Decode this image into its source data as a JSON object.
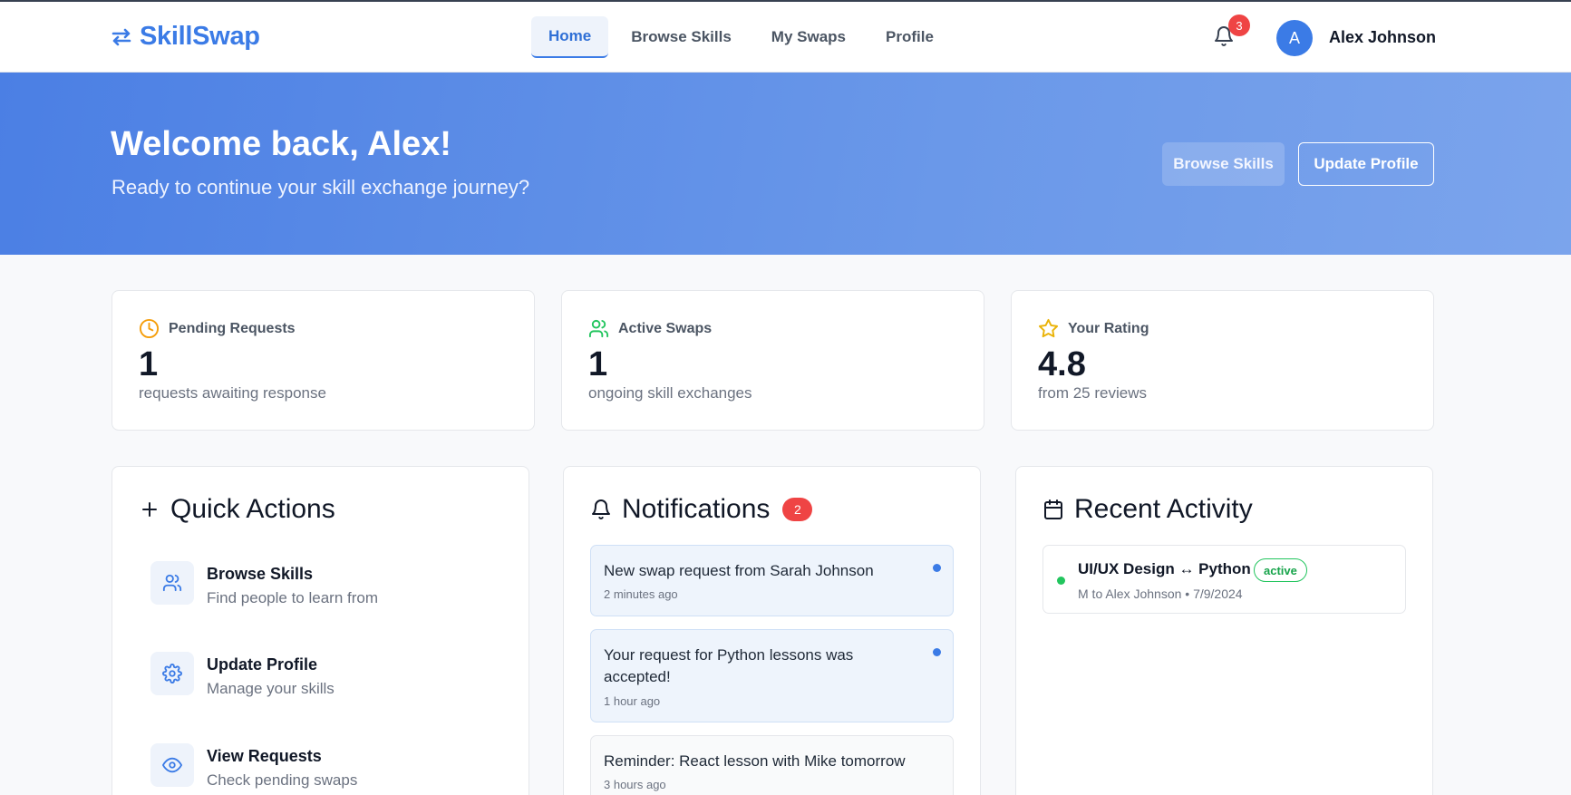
{
  "app": {
    "name": "SkillSwap",
    "brand_color": "#3b7be6"
  },
  "nav": {
    "items": [
      {
        "label": "Home",
        "active": true
      },
      {
        "label": "Browse Skills",
        "active": false
      },
      {
        "label": "My Swaps",
        "active": false
      },
      {
        "label": "Profile",
        "active": false
      }
    ]
  },
  "header": {
    "bell_icon": "bell-icon",
    "notification_count": "3",
    "avatar_initial": "A",
    "user_name": "Alex Johnson"
  },
  "hero": {
    "title": "Welcome back, Alex!",
    "subtitle": "Ready to continue your skill exchange journey?",
    "browse_button": "Browse Skills",
    "update_button": "Update Profile"
  },
  "stats": [
    {
      "icon": "clock-icon",
      "icon_color": "#f59e0b",
      "label": "Pending Requests",
      "value": "1",
      "desc": "requests awaiting response"
    },
    {
      "icon": "users-icon",
      "icon_color": "#22c55e",
      "label": "Active Swaps",
      "value": "1",
      "desc": "ongoing skill exchanges"
    },
    {
      "icon": "star-icon",
      "icon_color": "#eab308",
      "label": "Your Rating",
      "value": "4.8",
      "desc": "from 25 reviews"
    }
  ],
  "quick_actions": {
    "title": "Quick Actions",
    "items": [
      {
        "icon": "users-icon",
        "title": "Browse Skills",
        "desc": "Find people to learn from"
      },
      {
        "icon": "gear-icon",
        "title": "Update Profile",
        "desc": "Manage your skills"
      },
      {
        "icon": "eye-icon",
        "title": "View Requests",
        "desc": "Check pending swaps"
      }
    ]
  },
  "notifications": {
    "title": "Notifications",
    "unread_count": "2",
    "items": [
      {
        "text": "New swap request from Sarah Johnson",
        "time": "2 minutes ago",
        "unread": true
      },
      {
        "text": "Your request for Python lessons was accepted!",
        "time": "1 hour ago",
        "unread": true
      },
      {
        "text": "Reminder: React lesson with Mike tomorrow",
        "time": "3 hours ago",
        "unread": false
      }
    ]
  },
  "recent_activity": {
    "title": "Recent Activity",
    "items": [
      {
        "title": "UI/UX Design ↔ Python",
        "status": "active",
        "meta": "M to Alex Johnson • 7/9/2024"
      }
    ]
  }
}
